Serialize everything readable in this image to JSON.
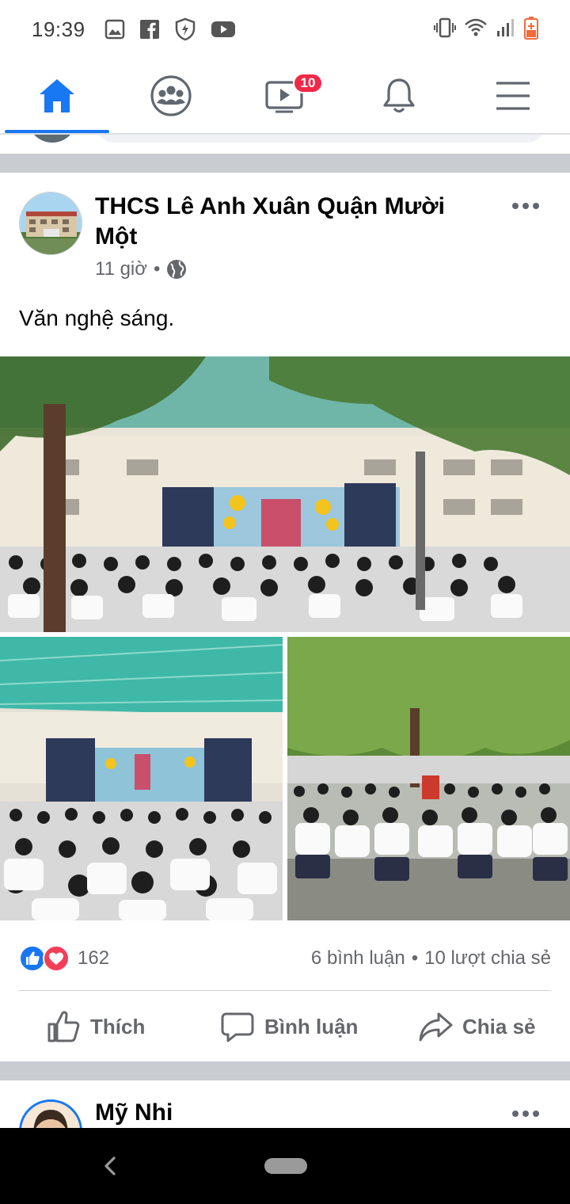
{
  "status_bar": {
    "time": "19:39",
    "left_icons": [
      "gallery-icon",
      "facebook-icon",
      "shield-icon",
      "youtube-icon"
    ],
    "right_icons": [
      "vibrate-icon",
      "wifi-icon",
      "signal-icon",
      "battery-icon"
    ]
  },
  "top_nav": {
    "tabs": [
      {
        "icon": "home-icon",
        "active": true
      },
      {
        "icon": "groups-icon",
        "active": false
      },
      {
        "icon": "watch-icon",
        "active": false,
        "badge": "10"
      },
      {
        "icon": "bell-icon",
        "active": false
      },
      {
        "icon": "menu-icon",
        "active": false
      }
    ],
    "accent": "#1877f2"
  },
  "post": {
    "author": "THCS Lê Anh Xuân Quận Mười Một",
    "time": "11 giờ",
    "separator": "•",
    "privacy_icon": "globe-icon",
    "text": "Văn nghệ sáng.",
    "photos": [
      "photo-stage-wide",
      "photo-stage-crowd",
      "photo-students-seated"
    ],
    "reactions": {
      "icons": [
        "like-icon",
        "love-icon"
      ],
      "count": "162"
    },
    "comments": "6 bình luận",
    "dot": "•",
    "shares": "10 lượt chia sẻ",
    "actions": {
      "like": "Thích",
      "comment": "Bình luận",
      "share": "Chia sẻ"
    }
  },
  "next_post": {
    "author": "Mỹ Nhi"
  },
  "colors": {
    "like": "#1877f2",
    "love": "#f33e58",
    "badge": "#f02849",
    "meta": "#65676b"
  }
}
